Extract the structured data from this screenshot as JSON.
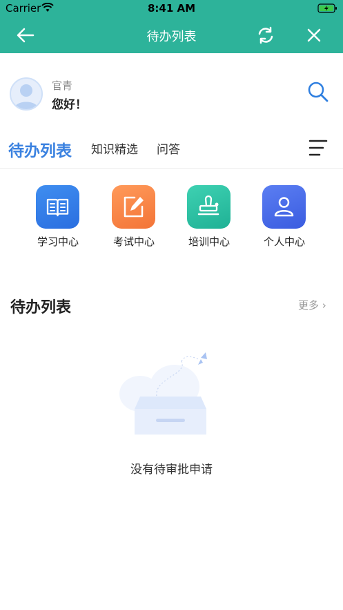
{
  "status_bar": {
    "carrier": "Carrier",
    "time": "8:41 AM"
  },
  "nav": {
    "title": "待办列表"
  },
  "profile": {
    "name": "官青",
    "greeting": "您好！"
  },
  "tabs": [
    {
      "label": "待办列表",
      "active": true
    },
    {
      "label": "知识精选",
      "active": false
    },
    {
      "label": "问答",
      "active": false
    }
  ],
  "quick_links": [
    {
      "label": "学习中心",
      "icon": "book-icon",
      "color": "#3a7fe8"
    },
    {
      "label": "考试中心",
      "icon": "edit-icon",
      "color": "#f6824a"
    },
    {
      "label": "培训中心",
      "icon": "stamp-icon",
      "color": "#2ec1a4"
    },
    {
      "label": "个人中心",
      "icon": "user-icon",
      "color": "#4a6de8"
    }
  ],
  "section": {
    "title": "待办列表",
    "more": "更多"
  },
  "empty": {
    "text": "没有待审批申请"
  },
  "colors": {
    "header": "#2db39a",
    "accent": "#3b82e0"
  }
}
